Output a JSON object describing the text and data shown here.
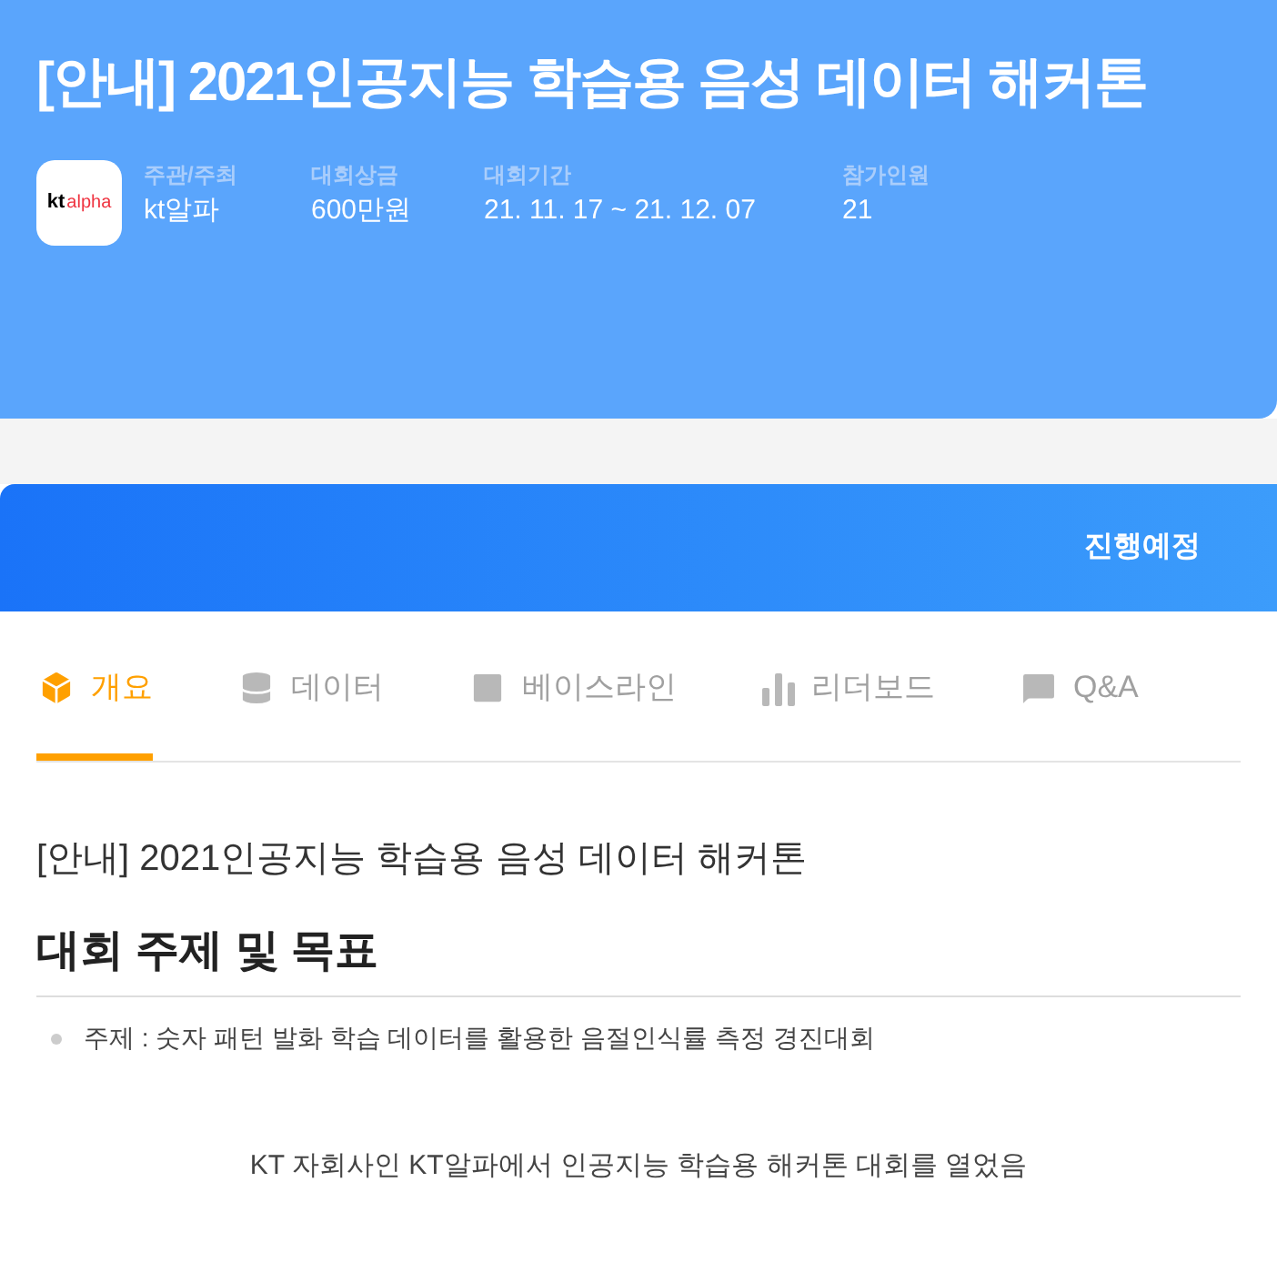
{
  "header": {
    "title": "[안내] 2021인공지능 학습용 음성 데이터 해커톤",
    "logo": {
      "part_1": "kt",
      "part_2": "alpha"
    },
    "info": [
      {
        "label": "주관/주최",
        "value": "kt알파"
      },
      {
        "label": "대회상금",
        "value": "600만원"
      },
      {
        "label": "대회기간",
        "value": "21. 11. 17 ~ 21. 12. 07"
      },
      {
        "label": "참가인원",
        "value": "21"
      }
    ]
  },
  "status_bar": {
    "status": "진행예정"
  },
  "tabs": [
    {
      "kind": "overview",
      "label": "개요",
      "selected": true
    },
    {
      "kind": "data",
      "label": "데이터",
      "selected": false
    },
    {
      "kind": "baseline",
      "label": "베이스라인",
      "selected": false
    },
    {
      "kind": "leaderboard",
      "label": "리더보드",
      "selected": false
    },
    {
      "kind": "qa",
      "label": "Q&A",
      "selected": false
    }
  ],
  "content": {
    "title": "[안내] 2021인공지능 학습용 음성 데이터 해커톤",
    "section_heading": "대회 주제 및 목표",
    "bullets": [
      "주제 : 숫자 패턴 발화 학습 데이터를 활용한 음절인식률 측정 경진대회"
    ],
    "paragraph": "KT 자회사인 KT알파에서 인공지능 학습용 해커톤 대회를 열었음"
  }
}
